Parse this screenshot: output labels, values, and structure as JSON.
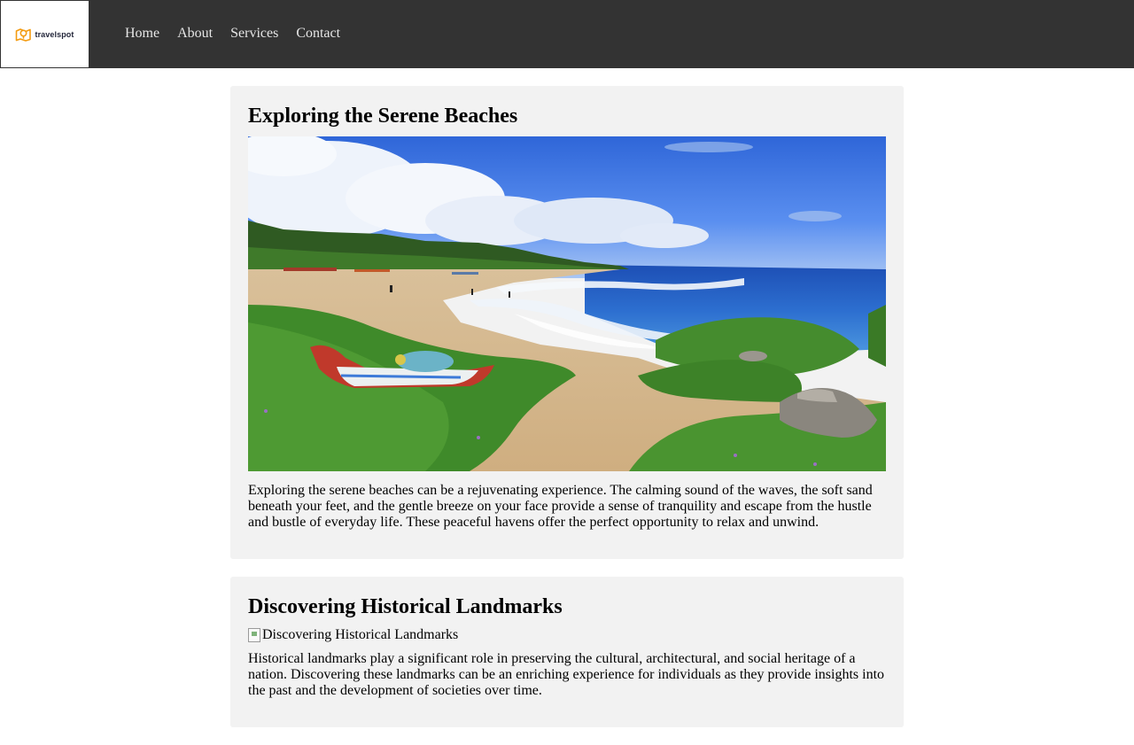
{
  "brand": {
    "logo_text": "travelspot",
    "accent_color": "#f39c12",
    "icon": "map-pin-map-icon"
  },
  "nav": {
    "items": [
      {
        "label": "Home"
      },
      {
        "label": "About"
      },
      {
        "label": "Services"
      },
      {
        "label": "Contact"
      }
    ]
  },
  "articles": [
    {
      "title": "Exploring the Serene Beaches",
      "image_alt": "Exploring the Serene Beaches",
      "body": "Exploring the serene beaches can be a rejuvenating experience. The calming sound of the waves, the soft sand beneath your feet, and the gentle breeze on your face provide a sense of tranquility and escape from the hustle and bustle of everyday life. These peaceful havens offer the perfect opportunity to relax and unwind."
    },
    {
      "title": "Discovering Historical Landmarks",
      "image_alt": "Discovering Historical Landmarks",
      "body": "Historical landmarks play a significant role in preserving the cultural, architectural, and social heritage of a nation. Discovering these landmarks can be an enriching experience for individuals as they provide insights into the past and the development of societies over time."
    }
  ],
  "colors": {
    "header_bg": "#333333",
    "card_bg": "#f2f2f2",
    "nav_text": "#e6e6e6"
  }
}
